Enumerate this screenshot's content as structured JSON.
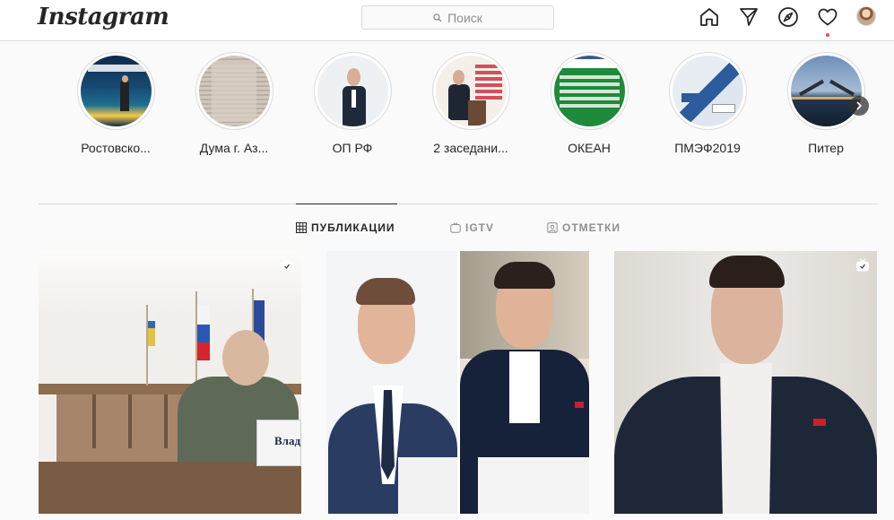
{
  "app": {
    "logo": "Instagram"
  },
  "search": {
    "placeholder": "Поиск"
  },
  "nav_icons": [
    "home-icon",
    "direct-icon",
    "explore-icon",
    "activity-icon",
    "profile-avatar"
  ],
  "highlights": [
    {
      "label": "Ростовско..."
    },
    {
      "label": "Дума г. Аз..."
    },
    {
      "label": "ОП РФ"
    },
    {
      "label": "2 заседани..."
    },
    {
      "label": "ОКЕАН"
    },
    {
      "label": "ПМЭФ2019"
    },
    {
      "label": "Питер"
    }
  ],
  "tabs": [
    {
      "label": "ПУБЛИКАЦИИ",
      "icon": "grid-icon",
      "active": true
    },
    {
      "label": "IGTV",
      "icon": "igtv-icon",
      "active": false
    },
    {
      "label": "ОТМЕТКИ",
      "icon": "tagged-icon",
      "active": false
    }
  ],
  "posts": [
    {
      "type": "igtv",
      "thumb_text": "Влад"
    },
    {
      "type": "photo"
    },
    {
      "type": "igtv"
    }
  ],
  "colors": {
    "border": "#dbdbdb",
    "text": "#262626",
    "muted": "#8e8e8e",
    "notification": "#ed4956"
  }
}
